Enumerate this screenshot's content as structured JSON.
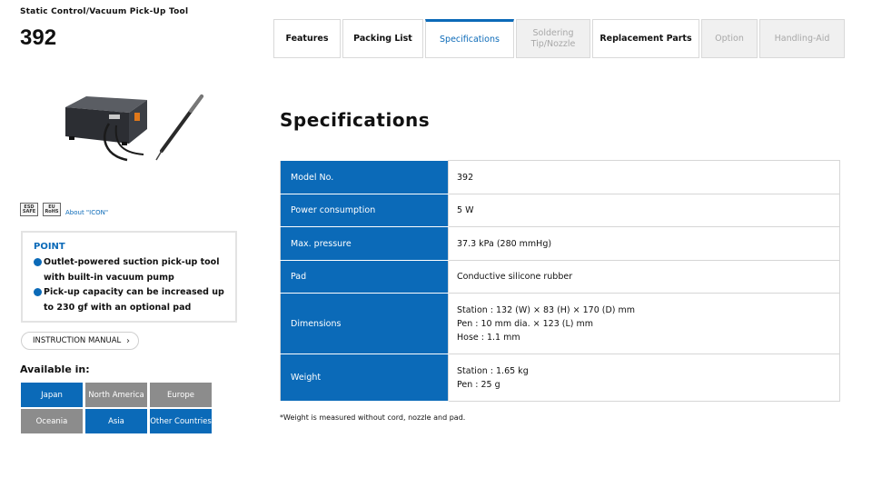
{
  "header": {
    "subtitle": "Static Control/Vacuum Pick-Up Tool",
    "model": "392"
  },
  "tabs": [
    {
      "label": "Features",
      "state": "normal"
    },
    {
      "label": "Packing List",
      "state": "normal"
    },
    {
      "label": "Specifications",
      "state": "active"
    },
    {
      "label": "Soldering Tip/Nozzle",
      "state": "disabled"
    },
    {
      "label": "Replacement Parts",
      "state": "normal"
    },
    {
      "label": "Option",
      "state": "disabled"
    },
    {
      "label": "Handling-Aid",
      "state": "disabled"
    }
  ],
  "badges": {
    "esd": "ESD SAFE",
    "rohs": "EU RoHS",
    "about": "About \"ICON\""
  },
  "point": {
    "title": "POINT",
    "items": [
      "Outlet-powered suction pick-up tool with built-in vacuum pump",
      "Pick-up capacity can be increased up to 230 gf with an optional pad"
    ]
  },
  "manual_button": "INSTRUCTION MANUAL",
  "available": {
    "label": "Available in:",
    "regions": [
      {
        "label": "Japan",
        "status": "blue"
      },
      {
        "label": "North America",
        "status": "gray"
      },
      {
        "label": "Europe",
        "status": "gray"
      },
      {
        "label": "Oceania",
        "status": "gray"
      },
      {
        "label": "Asia",
        "status": "blue"
      },
      {
        "label": "Other Countries",
        "status": "blue"
      }
    ]
  },
  "specs": {
    "heading": "Specifications",
    "rows": [
      {
        "key": "Model No.",
        "lines": [
          "392"
        ]
      },
      {
        "key": "Power consumption",
        "lines": [
          "5 W"
        ]
      },
      {
        "key": "Max. pressure",
        "lines": [
          "37.3 kPa (280 mmHg)"
        ]
      },
      {
        "key": "Pad",
        "lines": [
          "Conductive silicone rubber"
        ]
      },
      {
        "key": "Dimensions",
        "lines": [
          "Station : 132 (W) × 83 (H) × 170 (D) mm",
          "Pen : 10 mm dia. × 123 (L) mm",
          "Hose : 1.1 mm"
        ]
      },
      {
        "key": "Weight",
        "lines": [
          "Station : 1.65 kg",
          "Pen : 25 g"
        ]
      }
    ],
    "footnote": "*Weight is measured without cord, nozzle and pad."
  },
  "colors": {
    "accent": "#0b6ab8",
    "region_off": "#8c8c8c"
  }
}
